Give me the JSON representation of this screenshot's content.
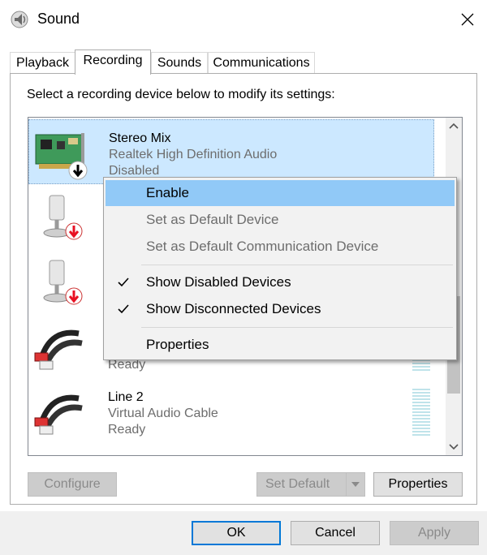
{
  "window": {
    "title": "Sound",
    "close_label": "✕"
  },
  "tabs": [
    {
      "label": "Playback"
    },
    {
      "label": "Recording"
    },
    {
      "label": "Sounds"
    },
    {
      "label": "Communications"
    }
  ],
  "instruction": "Select a recording device below to modify its settings:",
  "devices": [
    {
      "name": "Stereo Mix",
      "desc": "Realtek High Definition Audio",
      "status": "Disabled",
      "icon": "sound-card-icon"
    },
    {
      "name": "",
      "desc": "",
      "status": "",
      "icon": "microphone-icon"
    },
    {
      "name": "",
      "desc": "",
      "status": "",
      "icon": "microphone-icon"
    },
    {
      "name": "",
      "desc": "",
      "status": "Ready",
      "icon": "audio-cable-icon"
    },
    {
      "name": "Line 2",
      "desc": "Virtual Audio Cable",
      "status": "Ready",
      "icon": "audio-cable-icon"
    }
  ],
  "context_menu": {
    "items": [
      {
        "label": "Enable",
        "checked": false,
        "disabled": false,
        "highlighted": true
      },
      {
        "label": "Set as Default Device",
        "checked": false,
        "disabled": true
      },
      {
        "label": "Set as Default Communication Device",
        "checked": false,
        "disabled": true
      },
      {
        "label": "Show Disabled Devices",
        "checked": true,
        "disabled": false
      },
      {
        "label": "Show Disconnected Devices",
        "checked": true,
        "disabled": false
      },
      {
        "label": "Properties",
        "checked": false,
        "disabled": false
      }
    ]
  },
  "buttons": {
    "configure": "Configure",
    "set_default": "Set Default",
    "properties": "Properties",
    "ok": "OK",
    "cancel": "Cancel",
    "apply": "Apply"
  },
  "colors": {
    "selection": "#cce8ff",
    "menu_highlight": "#91c9f7",
    "accent": "#0078d7",
    "disabled_arrow": "#e81123"
  }
}
